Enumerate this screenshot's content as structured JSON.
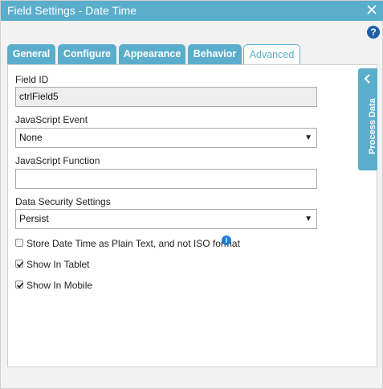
{
  "dialog": {
    "title": "Field Settings - Date Time",
    "help_label": "?"
  },
  "tabs": [
    {
      "label": "General"
    },
    {
      "label": "Configure"
    },
    {
      "label": "Appearance"
    },
    {
      "label": "Behavior"
    },
    {
      "label": "Advanced",
      "active": true
    }
  ],
  "form": {
    "field_id": {
      "label": "Field ID",
      "value": "ctrlField5"
    },
    "js_event": {
      "label": "JavaScript Event",
      "value": "None"
    },
    "js_function": {
      "label": "JavaScript Function",
      "value": ""
    },
    "data_security": {
      "label": "Data Security Settings",
      "value": "Persist"
    },
    "store_plain_text": {
      "label": "Store Date Time as Plain Text, and not ISO format",
      "checked": false
    },
    "show_in_tablet": {
      "label": "Show In Tablet",
      "checked": true
    },
    "show_in_mobile": {
      "label": "Show In Mobile",
      "checked": true
    }
  },
  "side_panel": {
    "label": "Process Data"
  },
  "colors": {
    "accent": "#5aaecc",
    "help": "#1f5ea8",
    "info": "#1f7bd6"
  },
  "icons": [
    "close-icon",
    "help-icon",
    "dropdown-arrow-icon",
    "checkmark-icon",
    "info-icon",
    "chevron-left-icon"
  ]
}
